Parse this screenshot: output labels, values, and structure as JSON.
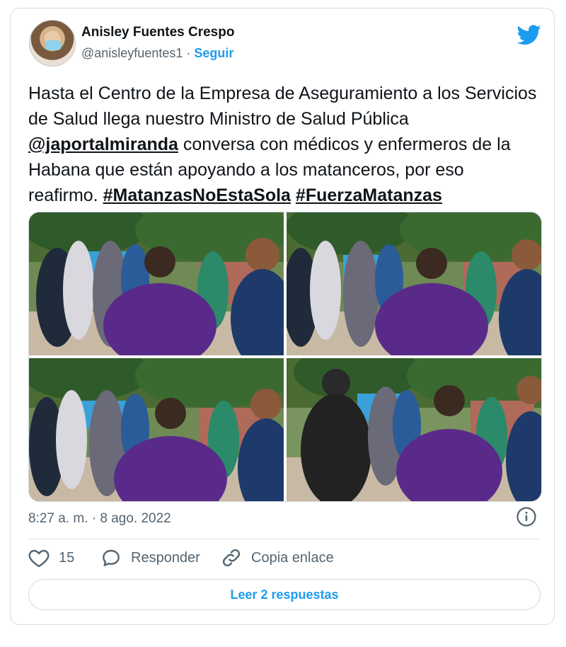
{
  "author": {
    "name": "Anisley Fuentes Crespo",
    "handle": "@anisleyfuentes1",
    "separator": "·",
    "follow_label": "Seguir"
  },
  "icons": {
    "brand": "twitter-bird-icon",
    "info": "info-icon",
    "like": "heart-icon",
    "reply": "reply-bubble-icon",
    "copy": "link-icon"
  },
  "colors": {
    "accent": "#1d9bf0",
    "text": "#0f1419",
    "muted": "#536471",
    "border": "#cfd9de"
  },
  "tweet": {
    "text_1": "Hasta el Centro de la Empresa de Aseguramiento a los Servicios de Salud llega nuestro Ministro de Salud Pública ",
    "mention": "@japortalmiranda",
    "text_2": " conversa con médicos y enfermeros de la Habana que están apoyando a los matanceros, por eso reafirmo. ",
    "hashtag_1": "#MatanzasNoEstaSola",
    "hashtag_2": "#FuerzaMatanzas",
    "timestamp": "8:27 a. m. · 8 ago. 2022"
  },
  "actions": {
    "likes_count": "15",
    "reply_label": "Responder",
    "copy_label": "Copia enlace"
  },
  "read_replies_label": "Leer 2 respuestas"
}
